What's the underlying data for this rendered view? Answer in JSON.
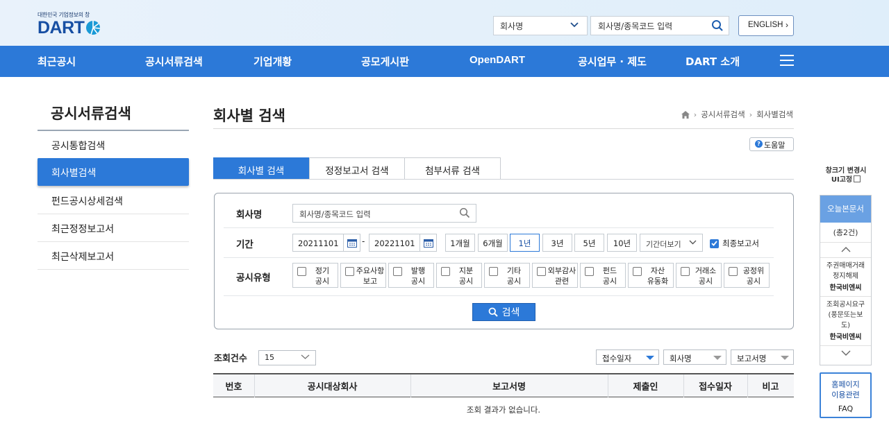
{
  "header": {
    "tagline": "대한민국 기업정보의 창",
    "logo_text": "DART",
    "company_select": "회사명",
    "search_placeholder": "회사명/종목코드 입력",
    "english_label": "ENGLISH"
  },
  "nav": {
    "items": [
      "최근공시",
      "공시서류검색",
      "기업개황",
      "공모게시판",
      "OpenDART",
      "공시업무 · 제도",
      "DART 소개"
    ]
  },
  "sidebar": {
    "title": "공시서류검색",
    "items": [
      {
        "label": "공시통합검색"
      },
      {
        "label": "회사별검색"
      },
      {
        "label": "펀드공시상세검색"
      },
      {
        "label": "최근정정보고서"
      },
      {
        "label": "최근삭제보고서"
      }
    ]
  },
  "page": {
    "title": "회사별 검색",
    "breadcrumb": [
      "공시서류검색",
      "회사별검색"
    ],
    "help_label": "도움말"
  },
  "tabs": [
    "회사별 검색",
    "정정보고서 검색",
    "첨부서류 검색"
  ],
  "form": {
    "company_label": "회사명",
    "company_placeholder": "회사명/종목코드 입력",
    "period_label": "기간",
    "start_date": "20211101",
    "end_date": "20221101",
    "period_buttons": [
      "1개월",
      "6개월",
      "1년",
      "3년",
      "5년",
      "10년"
    ],
    "period_more": "기간더보기",
    "final_report_label": "최종보고서",
    "type_label": "공시유형",
    "types": [
      [
        "정기",
        "공시"
      ],
      [
        "주요사항",
        "보고"
      ],
      [
        "발행",
        "공시"
      ],
      [
        "지분",
        "공시"
      ],
      [
        "기타",
        "공시"
      ],
      [
        "외부감사",
        "관련"
      ],
      [
        "펀드",
        "공시"
      ],
      [
        "자산",
        "유동화"
      ],
      [
        "거래소",
        "공시"
      ],
      [
        "공정위",
        "공시"
      ]
    ],
    "search_button": "검색"
  },
  "results": {
    "count_label": "조회건수",
    "count_value": "15",
    "sort_options": [
      "접수일자",
      "회사명",
      "보고서명"
    ],
    "columns": [
      "번호",
      "공시대상회사",
      "보고서명",
      "제출인",
      "접수일자",
      "비고"
    ],
    "empty_message": "조회 결과가 없습니다."
  },
  "right": {
    "window_size_label": "창크기 변경시",
    "ui_fixed_label": "UI고정",
    "today_title": "오늘본문서",
    "today_count": "(총2건)",
    "today_items": [
      {
        "desc": [
          "주권매매거래",
          "정지해제"
        ],
        "company": "한국비엔씨"
      },
      {
        "desc": [
          "조회공시요구",
          "(풍문또는보",
          "도)"
        ],
        "company": "한국비엔씨"
      }
    ],
    "faq_lines": [
      "홈페이지",
      "이용관련"
    ],
    "faq_label": "FAQ"
  },
  "colors": {
    "primary": "#2c79d8",
    "brand": "#174fa3"
  }
}
